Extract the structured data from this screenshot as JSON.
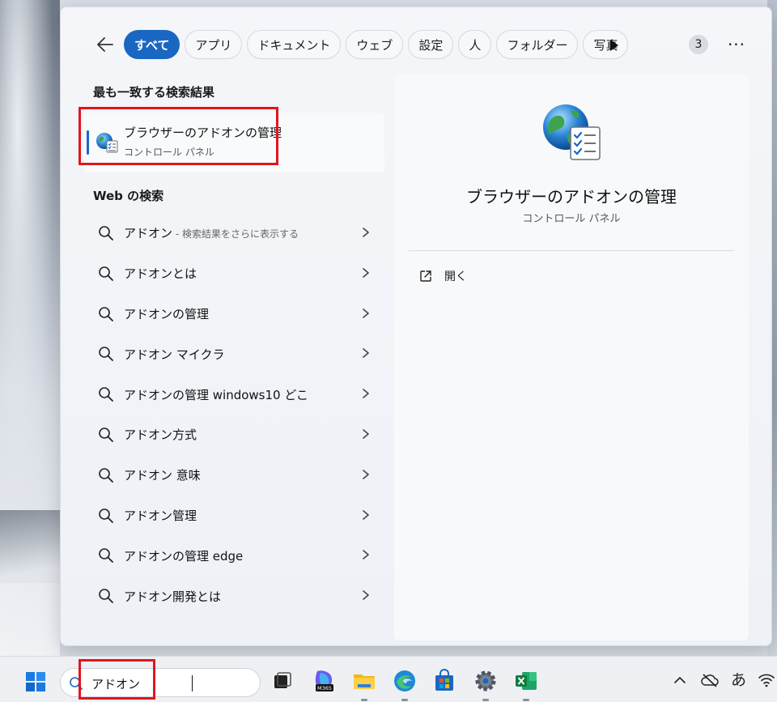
{
  "filter_bar": {
    "back_label": "",
    "chips": [
      {
        "label": "すべて",
        "active": true
      },
      {
        "label": "アプリ",
        "active": false
      },
      {
        "label": "ドキュメント",
        "active": false
      },
      {
        "label": "ウェブ",
        "active": false
      },
      {
        "label": "設定",
        "active": false
      },
      {
        "label": "人",
        "active": false
      },
      {
        "label": "フォルダー",
        "active": false
      },
      {
        "label": "写真",
        "active": false
      }
    ],
    "count_badge": "3",
    "more_label": "···"
  },
  "best_match": {
    "heading": "最も一致する検索結果",
    "title": "ブラウザーのアドオンの管理",
    "subtitle": "コントロール パネル",
    "icon": "globe-checklist-icon"
  },
  "web": {
    "heading": "Web の検索",
    "items": [
      {
        "label": "アドオン",
        "hint": " - 検索結果をさらに表示する"
      },
      {
        "label": "アドオンとは",
        "hint": ""
      },
      {
        "label": "アドオンの管理",
        "hint": ""
      },
      {
        "label": "アドオン マイクラ",
        "hint": ""
      },
      {
        "label": "アドオンの管理 windows10 どこ",
        "hint": ""
      },
      {
        "label": "アドオン方式",
        "hint": ""
      },
      {
        "label": "アドオン 意味",
        "hint": ""
      },
      {
        "label": "アドオン管理",
        "hint": ""
      },
      {
        "label": "アドオンの管理 edge",
        "hint": ""
      },
      {
        "label": "アドオン開発とは",
        "hint": ""
      }
    ]
  },
  "preview": {
    "title": "ブラウザーのアドオンの管理",
    "subtitle": "コントロール パネル",
    "open_label": "開く"
  },
  "taskbar": {
    "search_value": "アドオン",
    "apps": [
      "task-view-icon",
      "m365-copilot-icon",
      "file-explorer-icon",
      "edge-icon",
      "store-icon",
      "settings-icon",
      "excel-icon"
    ],
    "ime_label": "あ"
  },
  "colors": {
    "accent": "#1a67c3",
    "highlight": "#e0161c"
  }
}
